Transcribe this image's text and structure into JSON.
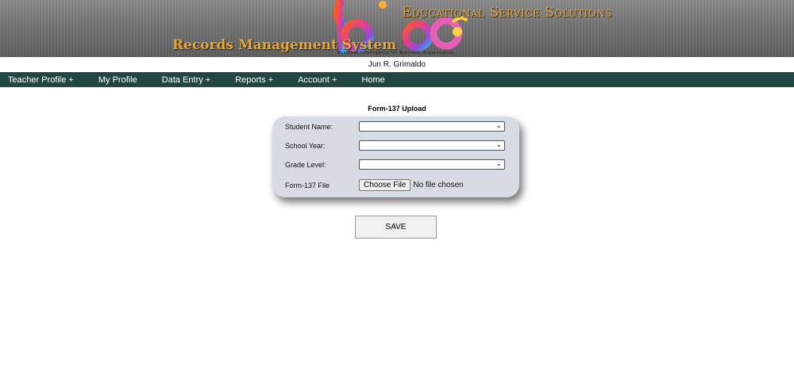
{
  "header": {
    "tagline": "Educational Service Solutions",
    "system_title": "Records Management System",
    "logo_text": "bibo",
    "logo_subtext": "Business Intelligence for Business Organization"
  },
  "user": {
    "name": "Jun R. Grimaldo"
  },
  "nav": {
    "items": [
      {
        "label": "Teacher Profile +"
      },
      {
        "label": "My Profile"
      },
      {
        "label": "Data Entry +"
      },
      {
        "label": "Reports +"
      },
      {
        "label": "Account +"
      },
      {
        "label": "Home"
      }
    ]
  },
  "form": {
    "title": "Form-137 Upload",
    "student_name_label": "Student Name:",
    "student_name_value": "",
    "school_year_label": "School Year:",
    "school_year_value": "",
    "grade_level_label": "Grade Level:",
    "grade_level_value": "",
    "file_label": "Form-137 File",
    "file_button_label": "Choose File",
    "file_status": "No file chosen",
    "save_label": "SAVE"
  },
  "colors": {
    "nav_background": "#224641",
    "card_background": "#d7dbe4",
    "title_gold": "#e2a63a"
  }
}
